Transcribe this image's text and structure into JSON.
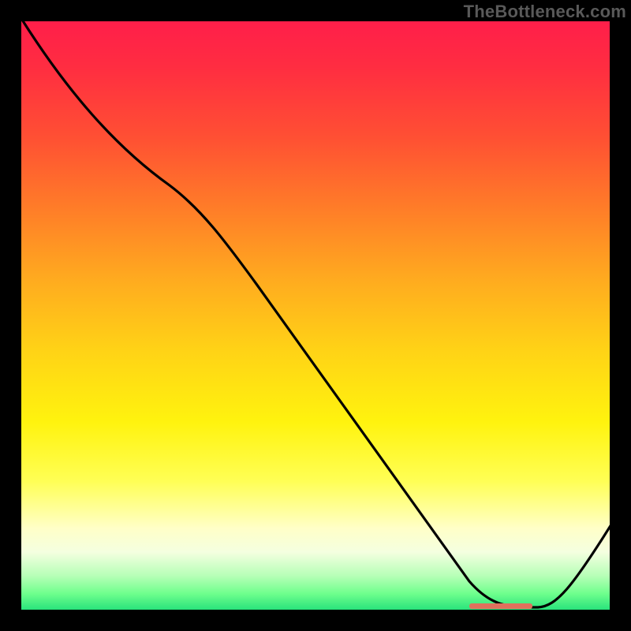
{
  "watermark": "TheBottleneck.com",
  "chart_data": {
    "type": "line",
    "title": "",
    "xlabel": "",
    "ylabel": "",
    "ylim": [
      0,
      100
    ],
    "xlim": [
      0,
      100
    ],
    "x": [
      0,
      5,
      10,
      15,
      20,
      25,
      30,
      35,
      40,
      45,
      50,
      55,
      60,
      65,
      70,
      75,
      80,
      85,
      88,
      95,
      100
    ],
    "values": [
      100,
      97,
      93,
      88,
      82,
      74,
      66,
      58,
      50,
      42,
      34,
      26,
      18,
      10,
      4,
      1,
      0,
      0,
      1,
      9,
      16
    ],
    "legend": "",
    "notes": "Descending curve from top-left to a flat minimum near x≈75–85, then rising toward the right edge. Background is a vertical heat gradient (red→yellow→green). Small salmon horizontal mark at the curve minimum near the x-axis.",
    "marker": {
      "x_range": [
        75,
        86
      ],
      "y": 0.7,
      "color": "#e07060"
    }
  }
}
